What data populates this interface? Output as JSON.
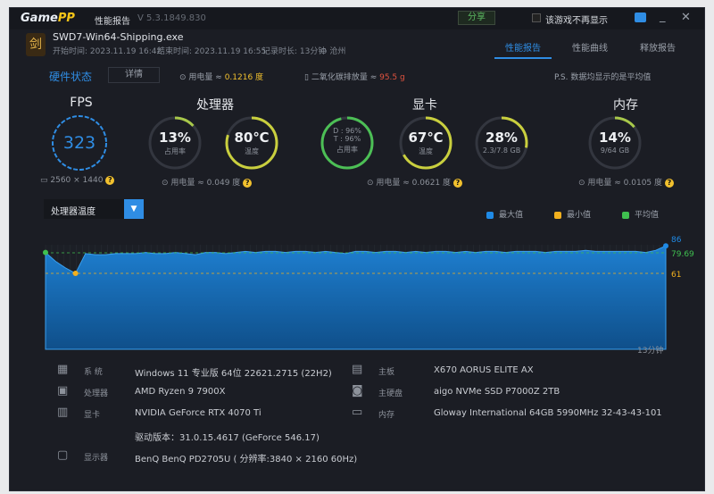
{
  "titlebar": {
    "logo_a": "Game",
    "logo_b": "PP",
    "title": "性能报告",
    "version": "V 5.3.1849.830",
    "share": "分享",
    "dont_show": "该游戏不再显示"
  },
  "header": {
    "exe": "SWD7-Win64-Shipping.exe",
    "start": "开始时间: 2023.11.19 16:42",
    "end": "结束时间: 2023.11.19 16:55",
    "duration": "记录时长: 13分钟",
    "location": "沧州",
    "tabs": [
      "性能报告",
      "性能曲线",
      "释放报告"
    ],
    "active_tab": 0
  },
  "hw": {
    "title": "硬件状态",
    "detail": "详情",
    "power": "用电量 ≈",
    "power_val": "0.1216 度",
    "co2": "二氧化碳排放量 ≈",
    "co2_val": "95.5 g",
    "note": "P.S. 数据均显示的是平均值"
  },
  "gauges": {
    "fps": {
      "title": "FPS",
      "value": "323",
      "res": "2560 × 1440"
    },
    "cpu": {
      "title": "处理器",
      "usage": "13%",
      "usage_label": "占用率",
      "usage_frac": 0.13,
      "temp": "80℃",
      "temp_label": "温度",
      "temp_frac": 0.8,
      "power": "用电量 ≈ 0.049 度"
    },
    "gpu": {
      "title": "显卡",
      "d": "D : 96%",
      "t": "T : 96%",
      "usage_label": "占用率",
      "usage_frac": 0.96,
      "temp": "67℃",
      "temp_label": "温度",
      "temp_frac": 0.67,
      "vram": "28%",
      "vram_sub": "2.3/7.8 GB",
      "vram_frac": 0.28,
      "power": "用电量 ≈ 0.0621 度"
    },
    "mem": {
      "title": "内存",
      "usage": "14%",
      "sub": "9/64 GB",
      "usage_frac": 0.14,
      "power": "用电量 ≈ 0.0105 度"
    }
  },
  "chart_data": {
    "type": "area",
    "title": "处理器温度",
    "xlabel": "13分钟",
    "ylim": [
      -8,
      87
    ],
    "legend": [
      "最大值",
      "最小值",
      "平均值"
    ],
    "colors": {
      "max": "#1f8ae6",
      "min": "#f2b01e",
      "avg": "#3fbf4f"
    },
    "max": 86,
    "min": 61,
    "avg": 79.69,
    "max_label": "86",
    "min_label": "61",
    "avg_label": "79.69",
    "values": [
      80,
      72,
      66,
      61,
      79,
      78,
      78,
      79,
      79,
      79,
      80,
      79,
      79,
      80,
      79,
      78,
      80,
      80,
      79,
      80,
      81,
      80,
      81,
      81,
      80,
      81,
      81,
      80,
      81,
      80,
      79,
      81,
      81,
      80,
      81,
      81,
      80,
      81,
      80,
      81,
      81,
      80,
      81,
      80,
      81,
      81,
      80,
      81,
      81,
      81,
      80,
      81,
      81,
      81,
      82,
      81,
      81,
      81,
      81,
      81,
      80,
      82,
      86
    ]
  },
  "specs": [
    {
      "icon": "system-icon",
      "label": "系 统",
      "value": "Windows 11 专业版 64位 22621.2715 (22H2)"
    },
    {
      "icon": "motherboard-icon",
      "label": "主板",
      "value": "X670 AORUS ELITE AX"
    },
    {
      "icon": "cpu-icon",
      "label": "处理器",
      "value": "AMD Ryzen 9 7900X"
    },
    {
      "icon": "disk-icon",
      "label": "主硬盘",
      "value": "aigo NVMe SSD P7000Z 2TB"
    },
    {
      "icon": "gpu-icon",
      "label": "显卡",
      "value": "NVIDIA GeForce RTX 4070 Ti"
    },
    {
      "icon": "memory-icon",
      "label": "内存",
      "value": "Gloway International 64GB 5990MHz 32-43-43-101"
    },
    {
      "icon": "",
      "label": "",
      "value": "驱动版本：31.0.15.4617 (GeForce 546.17)"
    },
    {
      "icon": "monitor-icon",
      "label": "显示器",
      "value": "BenQ BenQ PD2705U ( 分辨率:3840 × 2160 60Hz)"
    }
  ]
}
